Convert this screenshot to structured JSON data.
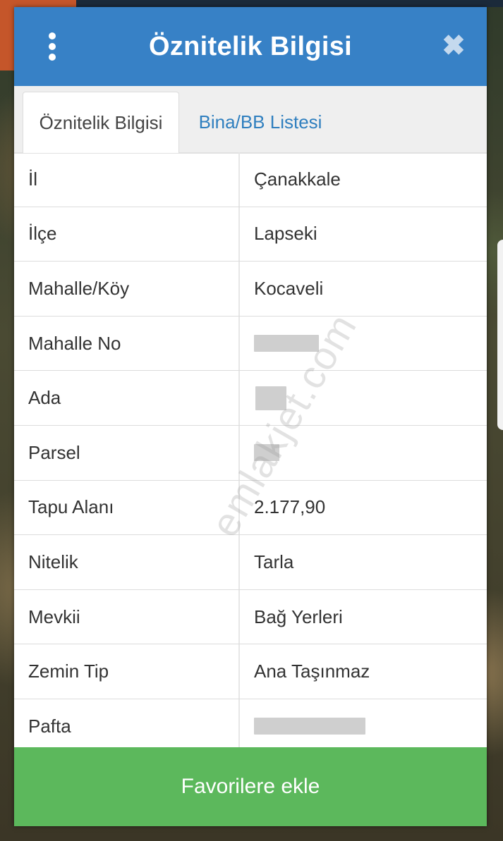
{
  "dialog": {
    "title": "Öznitelik Bilgisi",
    "menu_icon": "more-vertical-icon",
    "close_icon": "close-icon"
  },
  "tabs": [
    {
      "label": "Öznitelik Bilgisi",
      "active": true
    },
    {
      "label": "Bina/BB Listesi",
      "active": false
    }
  ],
  "rows": [
    {
      "key": "İl",
      "value": "Çanakkale"
    },
    {
      "key": "İlçe",
      "value": "Lapseki"
    },
    {
      "key": "Mahalle/Köy",
      "value": "Kocaveli"
    },
    {
      "key": "Mahalle No",
      "value": ""
    },
    {
      "key": "Ada",
      "value": ""
    },
    {
      "key": "Parsel",
      "value": ""
    },
    {
      "key": "Tapu Alanı",
      "value": "2.177,90"
    },
    {
      "key": "Nitelik",
      "value": "Tarla"
    },
    {
      "key": "Mevkii",
      "value": "Bağ Yerleri"
    },
    {
      "key": "Zemin Tip",
      "value": "Ana Taşınmaz"
    },
    {
      "key": "Pafta",
      "value": ""
    }
  ],
  "watermark": "emlakjet.com",
  "favorite_button": "Favorilere ekle",
  "colors": {
    "header": "#3781c6",
    "button": "#5cb85c",
    "tab_link": "#2f7fbf"
  }
}
